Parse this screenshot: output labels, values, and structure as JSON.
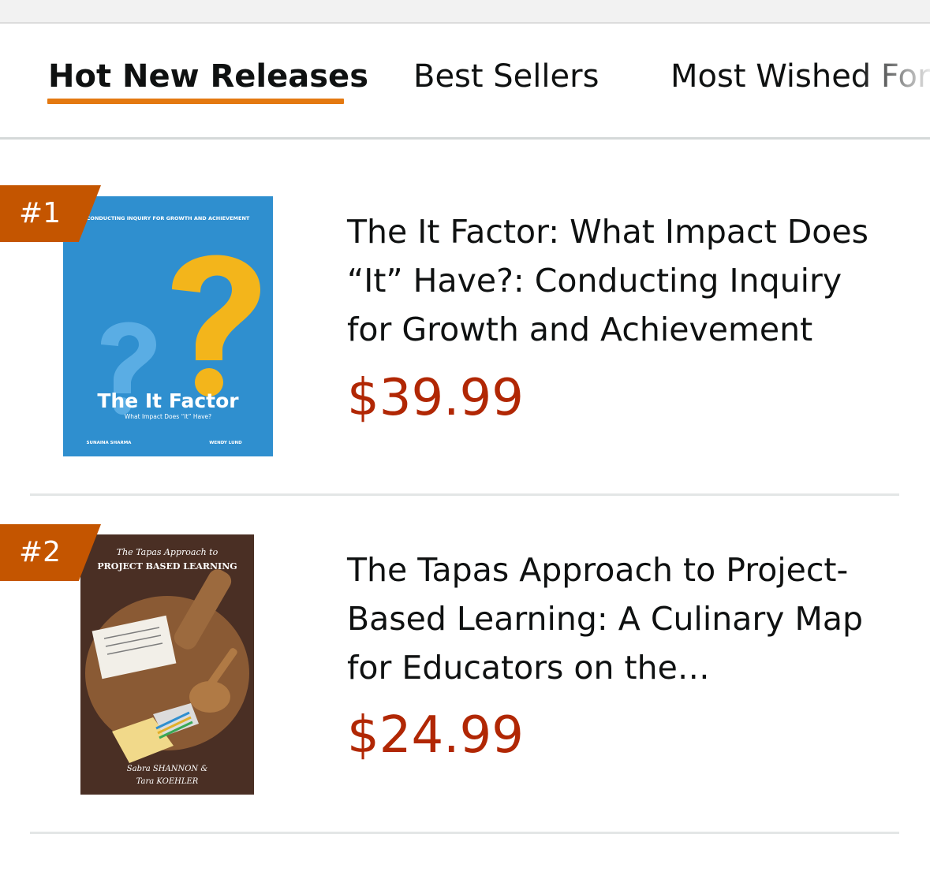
{
  "tabs": [
    {
      "label": "Hot New Releases",
      "active": true
    },
    {
      "label": "Best Sellers",
      "active": false
    },
    {
      "label": "Most Wished For",
      "active": false
    }
  ],
  "items": [
    {
      "rank": "#1",
      "title": "The It Factor: What Impact Does “It” Have?: Conducting Inquiry for Growth and Achievement",
      "price": "$39.99",
      "cover": {
        "top_text": "CONDUCTING INQUIRY FOR GROWTH AND ACHIEVEMENT",
        "title": "The It Factor",
        "subtitle": "What Impact Does “It” Have?",
        "author_left": "SUNAINA SHARMA",
        "author_right": "WENDY LUND",
        "background": "#2f8fcf",
        "accent": "#f3b51b"
      }
    },
    {
      "rank": "#2",
      "title": "The Tapas Approach to Project-Based Learning: A Culinary Map for Educators on the…",
      "price": "$24.99",
      "cover": {
        "top_text": "The Tapas Approach to",
        "top_text_2": "PROJECT BASED LEARNING",
        "authors_line_1": "Sabra SHANNON &",
        "authors_line_2": "Tara KOEHLER",
        "background": "#4a2f24",
        "board": "#8a5a34"
      }
    }
  ],
  "colors": {
    "accent_underline": "#e47911",
    "rank_badge": "#c45500",
    "price": "#b12704",
    "divider": "#e3e6e6"
  }
}
